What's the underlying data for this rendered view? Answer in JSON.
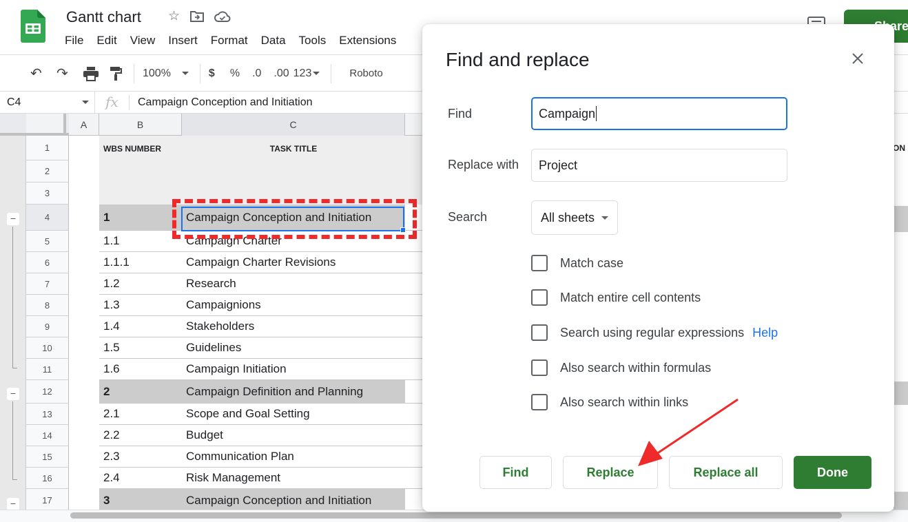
{
  "app": {
    "doc_title": "Gantt chart",
    "title_icons": [
      "star-icon",
      "move-to-folder-icon",
      "cloud-saved-icon"
    ],
    "menu": [
      "File",
      "Edit",
      "View",
      "Insert",
      "Format",
      "Data",
      "Tools",
      "Extensions"
    ],
    "share_label": "Share",
    "brand_color": "#2e7d32"
  },
  "toolbar": {
    "undo": "↶",
    "redo": "↷",
    "print": "🖶",
    "paint_format": "paint-format",
    "zoom": "100%",
    "currency": "$",
    "percent": "%",
    "decrease_decimal": ".0",
    "increase_decimal": ".00",
    "more_formats": "123",
    "font": "Roboto"
  },
  "formula_bar": {
    "cell_ref": "C4",
    "fx": "fx",
    "value": "Campaign Conception and Initiation"
  },
  "sheet": {
    "columns": [
      "A",
      "B",
      "C"
    ],
    "header_row": {
      "wbs": "WBS NUMBER",
      "task": "TASK TITLE",
      "right_partial": "ON"
    },
    "rows": [
      {
        "num": "1",
        "wbs": "",
        "task": "",
        "type": "hdr"
      },
      {
        "num": "2",
        "wbs": "",
        "task": "",
        "type": "hdr"
      },
      {
        "num": "3",
        "wbs": "",
        "task": "",
        "type": "hdr"
      },
      {
        "num": "4",
        "wbs": "1",
        "task": "Campaign Conception and Initiation",
        "type": "section"
      },
      {
        "num": "5",
        "wbs": "1.1",
        "task": "Campaign Charter",
        "type": "task"
      },
      {
        "num": "6",
        "wbs": "1.1.1",
        "task": "Campaign Charter Revisions",
        "type": "task"
      },
      {
        "num": "7",
        "wbs": "1.2",
        "task": "Research",
        "type": "task"
      },
      {
        "num": "8",
        "wbs": "1.3",
        "task": "Campaignions",
        "type": "task"
      },
      {
        "num": "9",
        "wbs": "1.4",
        "task": "Stakeholders",
        "type": "task"
      },
      {
        "num": "10",
        "wbs": "1.5",
        "task": "Guidelines",
        "type": "task"
      },
      {
        "num": "11",
        "wbs": "1.6",
        "task": "Campaign Initiation",
        "type": "task"
      },
      {
        "num": "12",
        "wbs": "2",
        "task": "Campaign Definition and Planning",
        "type": "section"
      },
      {
        "num": "13",
        "wbs": "2.1",
        "task": "Scope and Goal Setting",
        "type": "task"
      },
      {
        "num": "14",
        "wbs": "2.2",
        "task": "Budget",
        "type": "task"
      },
      {
        "num": "15",
        "wbs": "2.3",
        "task": "Communication Plan",
        "type": "task"
      },
      {
        "num": "16",
        "wbs": "2.4",
        "task": "Risk Management",
        "type": "task"
      },
      {
        "num": "17",
        "wbs": "3",
        "task": "Campaign Conception and Initiation",
        "type": "section"
      }
    ],
    "selected_cell": "C4"
  },
  "dialog": {
    "title": "Find and replace",
    "find_label": "Find",
    "find_value": "Campaign",
    "replace_label": "Replace with",
    "replace_value": "Project",
    "search_label": "Search",
    "search_value": "All sheets",
    "options": [
      {
        "label": "Match case",
        "checked": false
      },
      {
        "label": "Match entire cell contents",
        "checked": false
      },
      {
        "label": "Search using regular expressions",
        "checked": false
      },
      {
        "label": "Also search within formulas",
        "checked": false
      },
      {
        "label": "Also search within links",
        "checked": false
      }
    ],
    "help_label": "Help",
    "buttons": {
      "find": "Find",
      "replace": "Replace",
      "replace_all": "Replace all",
      "done": "Done"
    }
  },
  "annotations": {
    "highlight_color": "#ee2a2a",
    "arrow_target": "Replace"
  }
}
